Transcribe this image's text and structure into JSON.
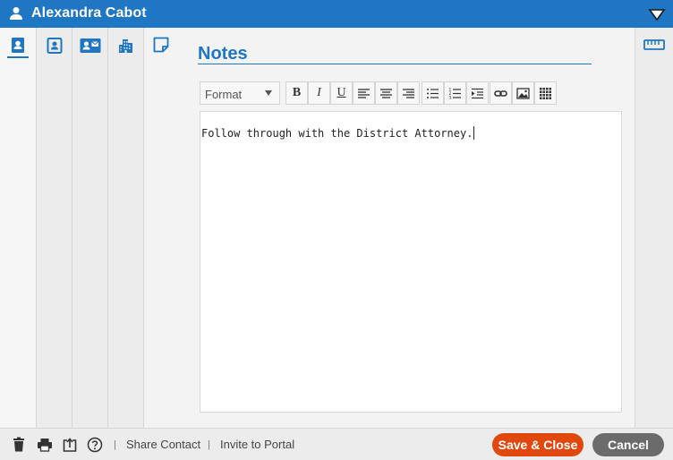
{
  "window": {
    "title": "Alexandra Cabot"
  },
  "tabs": [
    {
      "icon": "contact-card-icon",
      "active": true
    },
    {
      "icon": "person-card-icon",
      "active": false
    },
    {
      "icon": "business-card-icon",
      "active": false
    },
    {
      "icon": "building-icon",
      "active": false
    }
  ],
  "notes_panel": {
    "icon": "sticky-note-icon",
    "heading": "Notes"
  },
  "toolbar": {
    "format_label": "Format",
    "bold": "B",
    "italic": "I",
    "underline": "U"
  },
  "editor": {
    "content": "Follow through with the District Attorney."
  },
  "bottom_bar": {
    "share_contact": "Share Contact",
    "invite_portal": "Invite to Portal",
    "separator": "|",
    "save_close": "Save & Close",
    "cancel": "Cancel"
  },
  "colors": {
    "accent": "#1f76c2",
    "save": "#e0480e",
    "cancel": "#6b6b6b"
  }
}
